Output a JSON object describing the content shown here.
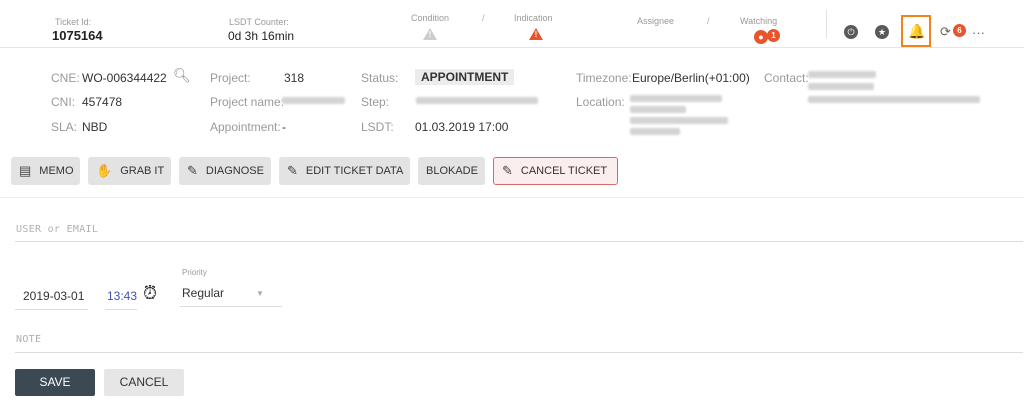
{
  "header": {
    "ticket_id_label": "Ticket Id:",
    "ticket_id": "1075164",
    "lsdt_counter_label": "LSDT Counter:",
    "lsdt_counter": "0d 3h 16min",
    "condition_label": "Condition",
    "separator": "/",
    "indication_label": "Indication",
    "assignee_label": "Assignee",
    "watching_label": "Watching",
    "watching_count": "1",
    "notification_count": "6",
    "more_label": "···",
    "colors": {
      "warning_grey": "#c8c8c8",
      "warning_orange": "#e8542c",
      "highlight": "#f0831c"
    }
  },
  "info": {
    "cne_label": "CNE:",
    "cne_value": "WO-006344422",
    "cni_label": "CNI:",
    "cni_value": "457478",
    "sla_label": "SLA:",
    "sla_value": "NBD",
    "project_label": "Project:",
    "project_value": "318",
    "project_name_label": "Project name:",
    "appointment_label": "Appointment:",
    "appointment_value": "-",
    "status_label": "Status:",
    "status_value": "APPOINTMENT",
    "step_label": "Step:",
    "lsdt_label": "LSDT:",
    "lsdt_value": "01.03.2019 17:00",
    "timezone_label": "Timezone:",
    "timezone_value": "Europe/Berlin(+01:00)",
    "location_label": "Location:",
    "contact_label": "Contact:"
  },
  "actions": {
    "memo": "MEMO",
    "grab_it": "GRAB IT",
    "diagnose": "DIAGNOSE",
    "edit_ticket_data": "EDIT TICKET DATA",
    "blokade": "BLOKADE",
    "cancel_ticket": "CANCEL TICKET"
  },
  "form": {
    "user_placeholder": "USER or EMAIL",
    "date_value": "2019-03-01",
    "time_value": "13:43",
    "priority_label": "Priority",
    "priority_value": "Regular",
    "note_placeholder": "NOTE",
    "save_label": "SAVE",
    "cancel_label": "CANCEL"
  }
}
